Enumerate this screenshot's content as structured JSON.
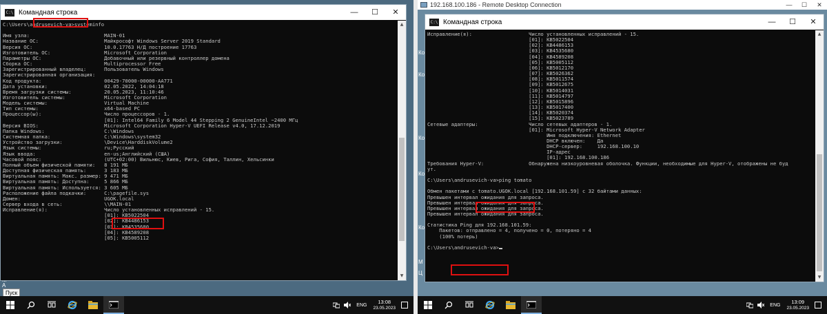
{
  "left": {
    "window_title": "Командная строка",
    "win_buttons": {
      "minimize": "—",
      "maximize": "☐",
      "close": "✕"
    },
    "lines": [
      "C:\\Users\\andrusevich-va>systeminfo",
      "",
      "Имя узла:                         MAIN-01",
      "Название ОС:                      Майкрософт Windows Server 2019 Standard",
      "Версия ОС:                        10.0.17763 Н/Д построение 17763",
      "Изготовитель ОС:                  Microsoft Corporation",
      "Параметры ОС:                     Добавочный или резервный контроллер домена",
      "Сборка ОС:                        Multiprocessor Free",
      "Зарегистрированный владелец:      Пользователь Windows",
      "Зарегистрированная организация:",
      "Код продукта:                     00429-70000-00000-AA771",
      "Дата установки:                   02.05.2022, 14:04:18",
      "Время загрузки системы:           20.05.2023, 11:10:46",
      "Изготовитель системы:             Microsoft Corporation",
      "Модель системы:                   Virtual Machine",
      "Тип системы:                      x64-based PC",
      "Процессор(ы):                     Число процессоров - 1.",
      "                                  [01]: Intel64 Family 6 Model 44 Stepping 2 GenuineIntel ~2400 МГц",
      "Версия BIOS:                      Microsoft Corporation Hyper-V UEFI Release v4.0, 17.12.2019",
      "Папка Windows:                    C:\\Windows",
      "Системная папка:                  C:\\Windows\\system32",
      "Устройство загрузки:              \\Device\\HarddiskVolume2",
      "Язык системы:                     ru;Русский",
      "Язык ввода:                       en-us;Английский (США)",
      "Часовой пояс:                     (UTC+02:00) Вильнюс, Киев, Рига, София, Таллин, Хельсинки",
      "Полный объем физической памяти:   8 191 МБ",
      "Доступная физическая память:      3 183 МБ",
      "Виртуальная память: Макс. размер: 9 471 МБ",
      "Виртуальная память: Доступна:     5 866 МБ",
      "Виртуальная память: Используется: 3 605 МБ",
      "Расположение файла подкачки:      C:\\pagefile.sys",
      "Домен:                            UGOK.local",
      "Сервер входа в сеть:              \\\\MAIN-01",
      "Исправление(я):                   Число установленных исправлений - 15.",
      "                                  [01]: KB5022504",
      "                                  [02]: KB4486153",
      "                                  [03]: KB4535680",
      "                                  [04]: KB4589208",
      "                                  [05]: KB5005112"
    ],
    "desktop_labels": [
      "Ко",
      "Ко",
      "Ко",
      "Ко",
      "Ко",
      "Ко",
      "Ко",
      "Ко",
      "М",
      "А"
    ],
    "tooltip": "Пуск",
    "taskbar": {
      "lang": "ENG",
      "time": "13:08",
      "date": "23.05.2023"
    }
  },
  "right": {
    "rdp_title": "192.168.100.186 - Remote Desktop Connection",
    "window_title": "Командная строка",
    "win_buttons": {
      "minimize": "—",
      "maximize": "☐",
      "close": "✕"
    },
    "lines": [
      "Исправление(я):                   Число установленных исправлений - 15.",
      "                                  [01]: KB5022504",
      "                                  [02]: KB4486153",
      "                                  [03]: KB4535680",
      "                                  [04]: KB4589208",
      "                                  [05]: KB5005112",
      "                                  [06]: KB5012170",
      "                                  [07]: KB5026362",
      "                                  [08]: KB5011574",
      "                                  [09]: KB5012675",
      "                                  [10]: KB5014031",
      "                                  [11]: KB5014797",
      "                                  [12]: KB5015896",
      "                                  [13]: KB5017400",
      "                                  [14]: KB5020374",
      "                                  [15]: KB5023789",
      "Сетевые адаптеры:                 Число сетевых адаптеров - 1.",
      "                                  [01]: Microsoft Hyper-V Network Adapter",
      "                                        Имя подключения: Ethernet",
      "                                        DHCP включен:    Да",
      "                                        DHCP-сервер:     192.168.100.10",
      "                                        IP-адрес",
      "                                        [01]: 192.168.100.186",
      "Требования Hyper-V:               Обнаружена низкоуровневая оболочка. Функции, необходимые для Hyper-V, отображены не буд",
      "ут.",
      "",
      "C:\\Users\\andrusevich-va>ping tomato",
      "",
      "Обмен пакетами с tomato.UGOK.local [192.168.101.59] с 32 байтами данных:",
      "Превышен интервал ожидания для запроса.",
      "Превышен интервал ожидания для запроса.",
      "Превышен интервал ожидания для запроса.",
      "Превышен интервал ожидания для запроса.",
      "",
      "Статистика Ping для 192.168.101.59:",
      "    Пакетов: отправлено = 4, получено = 0, потеряно = 4",
      "    (100% потерь)",
      "",
      "C:\\Users\\andrusevich-va>"
    ],
    "desktop_labels": [
      "Ко",
      "Ко",
      "Ко",
      "Ко",
      "Ко",
      "М",
      "Ц"
    ],
    "taskbar": {
      "lang": "ENG",
      "time": "13:09",
      "date": "23.05.2023"
    }
  }
}
